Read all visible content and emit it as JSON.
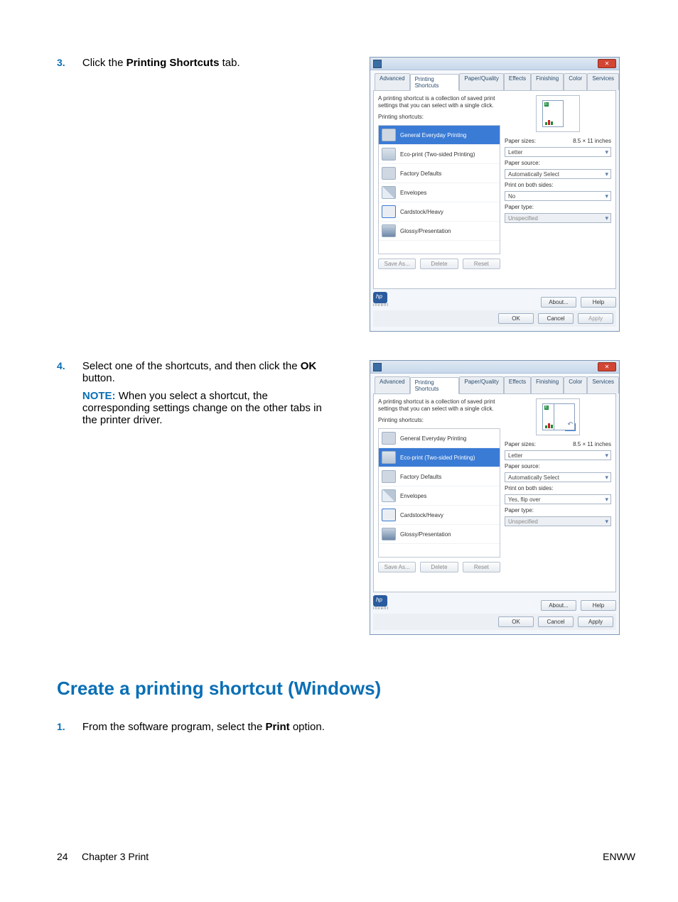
{
  "steps": {
    "three": {
      "num": "3.",
      "text_pre": "Click the ",
      "bold": "Printing Shortcuts",
      "text_post": " tab."
    },
    "four": {
      "num": "4.",
      "p1_pre": "Select one of the shortcuts, and then click the ",
      "p1_bold": "OK",
      "p1_post": " button.",
      "note_label": "NOTE:",
      "note_pre": "   When you select a shortcut, the corresponding settings change on the other tabs in the printer driver."
    },
    "h2": "Create a printing shortcut (Windows)",
    "one": {
      "num": "1.",
      "text_pre": "From the software program, select the ",
      "bold": "Print",
      "text_post": " option."
    }
  },
  "dialog": {
    "tabs": [
      "Advanced",
      "Printing Shortcuts",
      "Paper/Quality",
      "Effects",
      "Finishing",
      "Color",
      "Services"
    ],
    "desc": "A printing shortcut is a collection of saved print settings that you can select with a single click.",
    "list_label": "Printing shortcuts:",
    "everyday": "General Everyday Printing",
    "eco": "Eco-print (Two-sided Printing)",
    "factory": "Factory Defaults",
    "envelopes": "Envelopes",
    "cardstock": "Cardstock/Heavy",
    "glossy": "Glossy/Presentation",
    "save_as": "Save As...",
    "delete": "Delete",
    "reset": "Reset",
    "paper_sizes_label": "Paper sizes:",
    "paper_sizes_dim": "8.5 × 11 inches",
    "paper_sizes_value": "Letter",
    "paper_source_label": "Paper source:",
    "paper_source_value": "Automatically Select",
    "both_sides_label": "Print on both sides:",
    "both_no": "No",
    "both_yes": "Yes, flip over",
    "paper_type_label": "Paper type:",
    "paper_type_value": "Unspecified",
    "about": "About...",
    "help": "Help",
    "ok": "OK",
    "cancel": "Cancel",
    "apply": "Apply",
    "invent": "invent"
  },
  "footer": {
    "left_pre": "24",
    "chapter": "Chapter 3   Print",
    "right": "ENWW"
  }
}
